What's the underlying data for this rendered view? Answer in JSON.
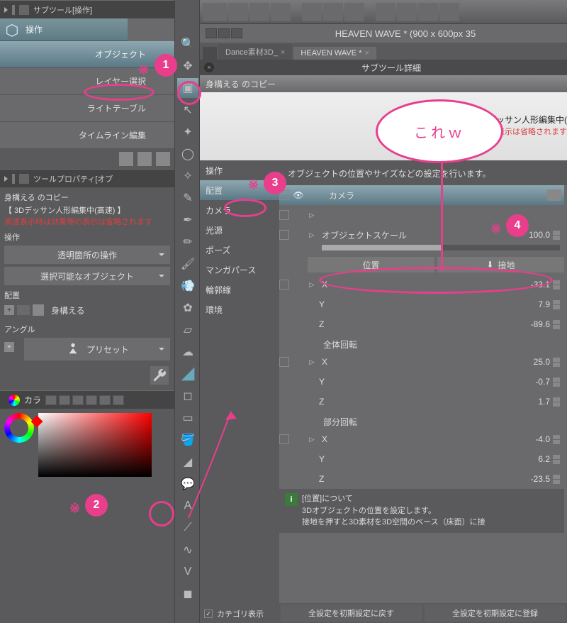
{
  "subtool_panel": {
    "title": "サブツール[操作]",
    "items": [
      {
        "label": "操作"
      },
      {
        "label": "オブジェクト"
      },
      {
        "label": "レイヤー選択"
      },
      {
        "label": "ライトテーブル"
      },
      {
        "label": "タイムライン編集"
      }
    ]
  },
  "tool_property": {
    "title": "ツールプロパティ[オブ",
    "copy_label": "身構える のコピー",
    "note_line1": "【 3Dデッサン人形編集中(高速) 】",
    "note_line2": "高速表示時は効果等の表示は省略されます",
    "section_operation": "操作",
    "dropdown_transparent": "透明箇所の操作",
    "dropdown_selectable": "選択可能なオブジェクト",
    "section_place": "配置",
    "item_pose_label": "身構える",
    "section_angle": "アングル",
    "preset_label": "プリセット"
  },
  "color_panel": {
    "title": "カラ"
  },
  "main": {
    "titlebar": "HEAVEN WAVE * (900 x 600px 35",
    "tabs": [
      {
        "label": "Dance素材3D_",
        "active": false
      },
      {
        "label": "HEAVEN WAVE *",
        "active": true
      }
    ]
  },
  "detail": {
    "header": "サブツール詳細",
    "copy_label": "身構える のコピー",
    "preview_line1": "【 3Dデッサン人形編集中(",
    "preview_line2": "高速表示時は効果等の表示は省略されます",
    "categories": [
      "操作",
      "配置",
      "カメラ",
      "光源",
      "ポーズ",
      "マンガパース",
      "輪郭線",
      "環境"
    ],
    "category_show": "カテゴリ表示",
    "note": "オブジェクトの位置やサイズなどの設定を行います。",
    "camera_label": "カメラ",
    "object_scale_label": "オブジェクトスケール",
    "object_scale_value": "100.0",
    "position_label": "位置",
    "ground_label": "接地",
    "position": {
      "X": "-33.1",
      "Y": "7.9",
      "Z": "-89.6"
    },
    "full_rotation_label": "全体回転",
    "full_rotation": {
      "X": "25.0",
      "Y": "-0.7",
      "Z": "1.7"
    },
    "part_rotation_label": "部分回転",
    "part_rotation": {
      "X": "-4.0",
      "Y": "6.2",
      "Z": "-23.5"
    },
    "info_title": "[位置]について",
    "info_body1": "3Dオブジェクトの位置を設定します。",
    "info_body2": "接地を押すと3D素材を3D空間のベース（床面）に接",
    "footer_reset": "全設定を初期設定に戻す",
    "footer_save": "全設定を初期設定に登録"
  },
  "annotations": {
    "b1": "1",
    "b2": "2",
    "b3": "3",
    "b4": "4",
    "x": "※",
    "speech": "これｗ"
  }
}
